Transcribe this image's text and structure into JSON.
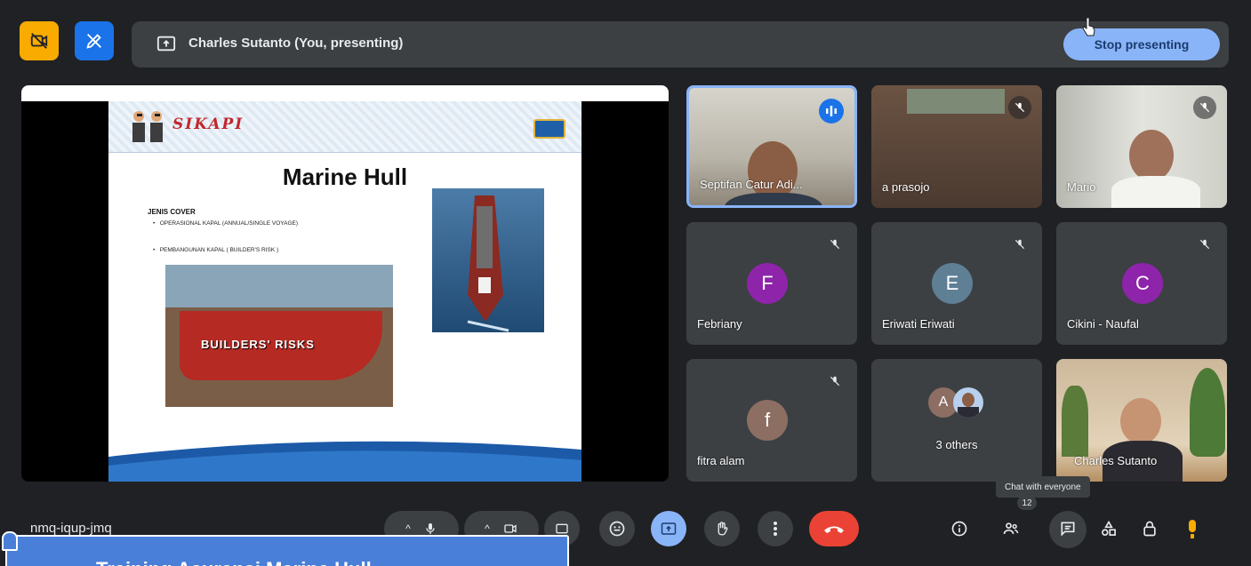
{
  "top_bar": {
    "presenting_label": "Charles Sutanto (You, presenting)",
    "stop_presenting": "Stop presenting"
  },
  "slide": {
    "logo_text": "SIKAPI",
    "title": "Marine Hull",
    "subheading": "JENIS COVER",
    "bullets": [
      "OPERASIONAL KAPAL (ANNUAL/SINGLE VOYAGE)",
      "PEMBANGUNAN KAPAL ( BUILDER'S RISK )"
    ],
    "image_caption": "BUILDERS' RISKS"
  },
  "participants": [
    {
      "name": "Septifan Catur Adi...",
      "state": "speaking"
    },
    {
      "name": "a prasojo",
      "state": "muted"
    },
    {
      "name": "Mario",
      "state": "muted"
    },
    {
      "name": "Febriany",
      "initial": "F",
      "color": "#8e24aa",
      "state": "muted"
    },
    {
      "name": "Eriwati Eriwati",
      "initial": "E",
      "color": "#5f7f94",
      "state": "muted"
    },
    {
      "name": "Cikini - Naufal",
      "initial": "C",
      "color": "#8e24aa",
      "state": "muted"
    },
    {
      "name": "fitra alam",
      "initial": "f",
      "color": "#8d6e63",
      "state": "muted"
    },
    {
      "name": "3 others",
      "initial": "A",
      "color": "#8d6e63"
    },
    {
      "name": "Charles Sutanto"
    }
  ],
  "bottom_bar": {
    "meeting_code": "nmq-iqup-jmq",
    "people_count": "12",
    "chat_tooltip": "Chat with everyone"
  },
  "overlay": {
    "caption_text": "Training Asuransi Marine Hull"
  },
  "colors": {
    "background": "#202124",
    "surface": "#3c4043",
    "accent_blue": "#8ab4f8",
    "end_call_red": "#ea4335",
    "presenting_yellow": "#f9ab00"
  }
}
